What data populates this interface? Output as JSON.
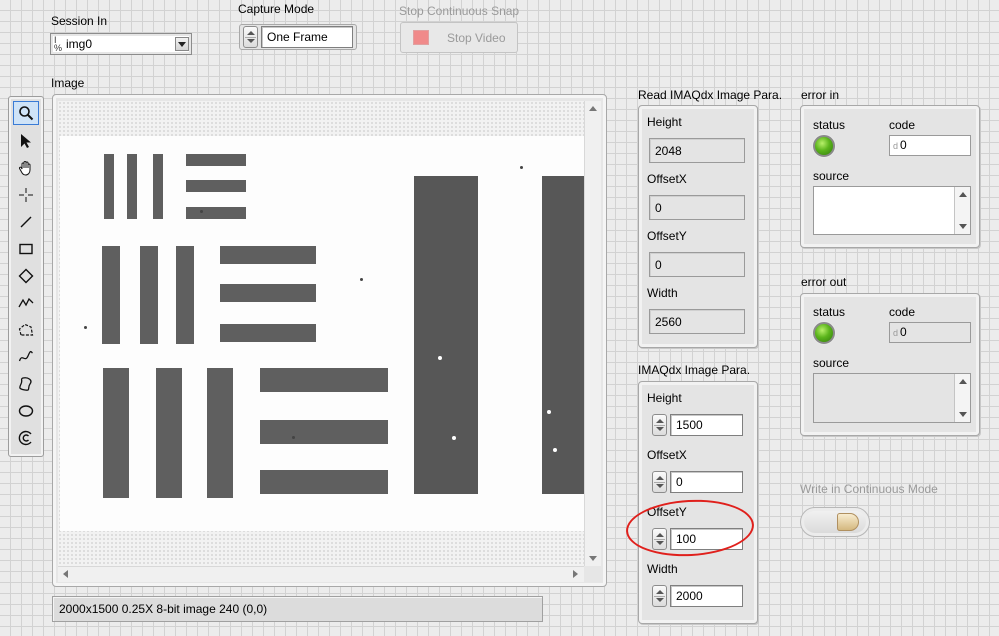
{
  "session_in": {
    "label": "Session In",
    "value": "img0",
    "icon": "io-name-icon"
  },
  "capture_mode": {
    "label": "Capture Mode",
    "value": "One Frame"
  },
  "stop_snap": {
    "label": "Stop Continuous Snap",
    "button_label": "Stop Video",
    "enabled": false
  },
  "image_display": {
    "label": "Image",
    "status_text": "2000x1500 0.25X 8-bit image 240    (0,0)"
  },
  "tool_palette": {
    "tools": [
      {
        "name": "zoom-tool-icon",
        "active": true
      },
      {
        "name": "pointer-tool-icon",
        "active": false
      },
      {
        "name": "pan-tool-icon",
        "active": false
      },
      {
        "name": "crosshair-tool-icon",
        "active": false
      },
      {
        "name": "line-tool-icon",
        "active": false
      },
      {
        "name": "rectangle-tool-icon",
        "active": false
      },
      {
        "name": "rotated-rectangle-tool-icon",
        "active": false
      },
      {
        "name": "polyline-tool-icon",
        "active": false
      },
      {
        "name": "polygon-tool-icon",
        "active": false
      },
      {
        "name": "freeline-tool-icon",
        "active": false
      },
      {
        "name": "freehand-region-tool-icon",
        "active": false
      },
      {
        "name": "oval-tool-icon",
        "active": false
      },
      {
        "name": "annulus-tool-icon",
        "active": false
      }
    ]
  },
  "read_params": {
    "label": "Read IMAQdx Image Para.",
    "fields": [
      {
        "label": "Height",
        "value": "2048"
      },
      {
        "label": "OffsetX",
        "value": "0"
      },
      {
        "label": "OffsetY",
        "value": "0"
      },
      {
        "label": "Width",
        "value": "2560"
      }
    ]
  },
  "write_params": {
    "label": "IMAQdx Image Para.",
    "fields": [
      {
        "label": "Height",
        "value": "1500"
      },
      {
        "label": "OffsetX",
        "value": "0"
      },
      {
        "label": "OffsetY",
        "value": "100"
      },
      {
        "label": "Width",
        "value": "2000"
      }
    ]
  },
  "error_in": {
    "label": "error in",
    "status_label": "status",
    "code_label": "code",
    "code_value": "0",
    "source_label": "source",
    "source_value": "",
    "radix": "d",
    "status_color": "#5cb51c"
  },
  "error_out": {
    "label": "error out",
    "status_label": "status",
    "code_label": "code",
    "code_value": "0",
    "source_label": "source",
    "source_value": "",
    "radix": "d",
    "status_color": "#5cb51c"
  },
  "write_continuous": {
    "label": "Write in Continuous Mode",
    "enabled": false
  },
  "colors": {
    "annotation": "#e0201c",
    "disabled_text": "#9a9a9a"
  }
}
